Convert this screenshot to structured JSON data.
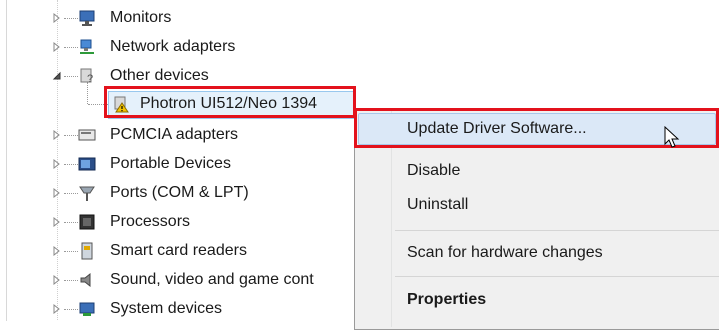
{
  "tree": {
    "items": [
      {
        "label": "Monitors",
        "icon": "monitor-icon",
        "expander": "collapsed"
      },
      {
        "label": "Network adapters",
        "icon": "network-adapter-icon",
        "expander": "collapsed"
      },
      {
        "label": "Other devices",
        "icon": "other-devices-icon",
        "expander": "expanded"
      },
      {
        "label": "Photron UI512/Neo 1394",
        "icon": "warning-device-icon",
        "expander": "none"
      },
      {
        "label": "PCMCIA adapters",
        "icon": "pcmcia-icon",
        "expander": "collapsed"
      },
      {
        "label": "Portable Devices",
        "icon": "portable-device-icon",
        "expander": "collapsed"
      },
      {
        "label": "Ports (COM & LPT)",
        "icon": "ports-icon",
        "expander": "collapsed"
      },
      {
        "label": "Processors",
        "icon": "processor-icon",
        "expander": "collapsed"
      },
      {
        "label": "Smart card readers",
        "icon": "smart-card-icon",
        "expander": "collapsed"
      },
      {
        "label": "Sound, video and game cont",
        "icon": "sound-icon",
        "expander": "collapsed"
      },
      {
        "label": "System devices",
        "icon": "system-device-icon",
        "expander": "collapsed"
      }
    ]
  },
  "context_menu": {
    "items": [
      {
        "label": "Update Driver Software..."
      },
      {
        "label": "Disable"
      },
      {
        "label": "Uninstall"
      },
      {
        "label": "Scan for hardware changes"
      },
      {
        "label": "Properties"
      }
    ]
  },
  "colors": {
    "highlight": "#e3121c",
    "selection": "#e5f1fb",
    "menu_background": "#f0f0f0"
  }
}
